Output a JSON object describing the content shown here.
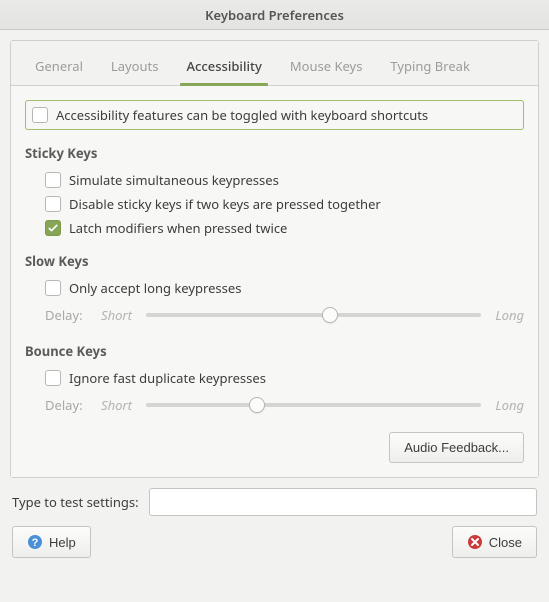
{
  "window": {
    "title": "Keyboard Preferences"
  },
  "tabs": {
    "items": [
      {
        "label": "General"
      },
      {
        "label": "Layouts"
      },
      {
        "label": "Accessibility"
      },
      {
        "label": "Mouse Keys"
      },
      {
        "label": "Typing Break"
      }
    ],
    "active_index": 2
  },
  "toggle_line": {
    "label": "Accessibility features can be toggled with keyboard shortcuts",
    "checked": false
  },
  "sticky": {
    "heading": "Sticky Keys",
    "simulate": {
      "label": "Simulate simultaneous keypresses",
      "checked": false
    },
    "disable_two": {
      "label": "Disable sticky keys if two keys are pressed together",
      "checked": false
    },
    "latch": {
      "label": "Latch modifiers when pressed twice",
      "checked": true
    }
  },
  "slow": {
    "heading": "Slow Keys",
    "only_long": {
      "label": "Only accept long keypresses",
      "checked": false
    },
    "delay_label": "Delay:",
    "short_label": "Short",
    "long_label": "Long",
    "value_pct": 55
  },
  "bounce": {
    "heading": "Bounce Keys",
    "ignore_fast": {
      "label": "Ignore fast duplicate keypresses",
      "checked": false
    },
    "delay_label": "Delay:",
    "short_label": "Short",
    "long_label": "Long",
    "value_pct": 33
  },
  "audio_button": "Audio Feedback...",
  "test_label": "Type to test settings:",
  "test_value": "",
  "buttons": {
    "help": "Help",
    "close": "Close"
  }
}
